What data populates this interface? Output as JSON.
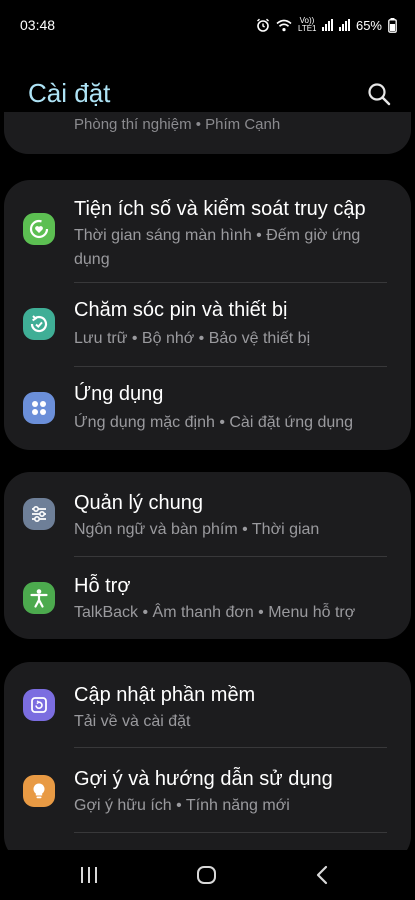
{
  "status_bar": {
    "time": "03:48",
    "network_label": "Vo)) LTE1",
    "battery": "65%",
    "icons": [
      "alarm-icon",
      "wifi-icon",
      "signal-icon",
      "battery-icon"
    ]
  },
  "header": {
    "title": "Cài đặt",
    "search_icon": "search-icon"
  },
  "partial_item": {
    "subtitle": "Phòng thí nghiệm  •  Phím Cạnh"
  },
  "groups": [
    {
      "items": [
        {
          "title": "Tiện ích số và kiểm soát truy cập",
          "subtitle": "Thời gian sáng màn hình  •  Đếm giờ ứng dụng",
          "icon": "digital-wellbeing-icon",
          "color": "#5cbf52"
        },
        {
          "title": "Chăm sóc pin và thiết bị",
          "subtitle": "Lưu trữ  •  Bộ nhớ  •  Bảo vệ thiết bị",
          "icon": "device-care-icon",
          "color": "#3fae96"
        },
        {
          "title": "Ứng dụng",
          "subtitle": "Ứng dụng mặc định  •  Cài đặt ứng dụng",
          "icon": "apps-icon",
          "color": "#6b8fd9"
        }
      ]
    },
    {
      "items": [
        {
          "title": "Quản lý chung",
          "subtitle": "Ngôn ngữ và bàn phím  •  Thời gian",
          "icon": "general-management-icon",
          "color": "#6e7f98"
        },
        {
          "title": "Hỗ trợ",
          "subtitle": "TalkBack  •  Âm thanh đơn  •  Menu hỗ trợ",
          "icon": "accessibility-icon",
          "color": "#4caa4e"
        }
      ]
    },
    {
      "items": [
        {
          "title": "Cập nhật phần mềm",
          "subtitle": "Tải về và cài đặt",
          "icon": "software-update-icon",
          "color": "#7b6de0"
        },
        {
          "title": "Gợi ý và hướng dẫn sử dụng",
          "subtitle": "Gợi ý hữu ích  •  Tính năng mới",
          "icon": "tips-icon",
          "color": "#e89a44"
        }
      ]
    }
  ],
  "nav_bar": {
    "buttons": [
      "recents-icon",
      "home-icon",
      "back-icon"
    ]
  }
}
